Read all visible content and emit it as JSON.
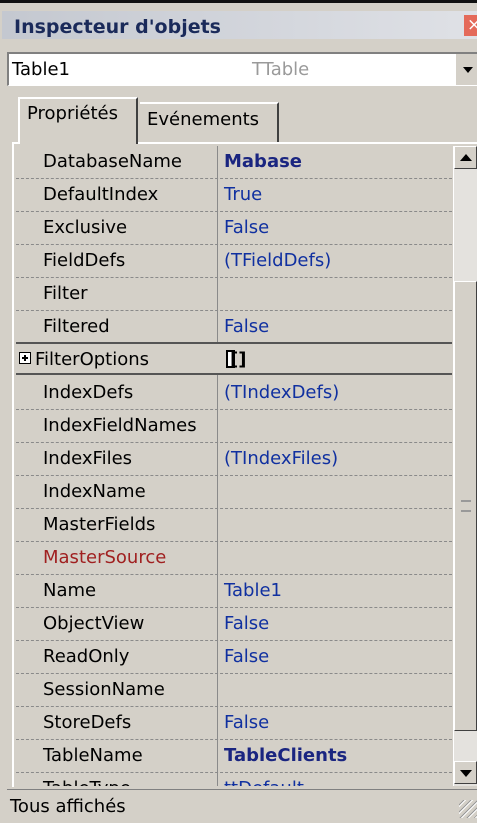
{
  "window": {
    "title": "Inspecteur d'objets"
  },
  "selector": {
    "name": "Table1",
    "type": "TTable"
  },
  "tabs": {
    "properties": "Propriétés",
    "events": "Evénements"
  },
  "properties": [
    {
      "name": "DatabaseName",
      "value": "Mabase"
    },
    {
      "name": "DefaultIndex",
      "value": "True"
    },
    {
      "name": "Exclusive",
      "value": "False"
    },
    {
      "name": "FieldDefs",
      "value": "(TFieldDefs)"
    },
    {
      "name": "Filter",
      "value": ""
    },
    {
      "name": "Filtered",
      "value": "False"
    },
    {
      "name": "FilterOptions",
      "value": "[]"
    },
    {
      "name": "IndexDefs",
      "value": "(TIndexDefs)"
    },
    {
      "name": "IndexFieldNames",
      "value": ""
    },
    {
      "name": "IndexFiles",
      "value": "(TIndexFiles)"
    },
    {
      "name": "IndexName",
      "value": ""
    },
    {
      "name": "MasterFields",
      "value": ""
    },
    {
      "name": "MasterSource",
      "value": ""
    },
    {
      "name": "Name",
      "value": "Table1"
    },
    {
      "name": "ObjectView",
      "value": "False"
    },
    {
      "name": "ReadOnly",
      "value": "False"
    },
    {
      "name": "SessionName",
      "value": ""
    },
    {
      "name": "StoreDefs",
      "value": "False"
    },
    {
      "name": "TableName",
      "value": "TableClients"
    },
    {
      "name": "TableType",
      "value": "ttDefault"
    }
  ],
  "colors": {
    "value_text": "#1030a0",
    "link_property": "#a02020"
  },
  "status": {
    "text": "Tous affichés"
  }
}
